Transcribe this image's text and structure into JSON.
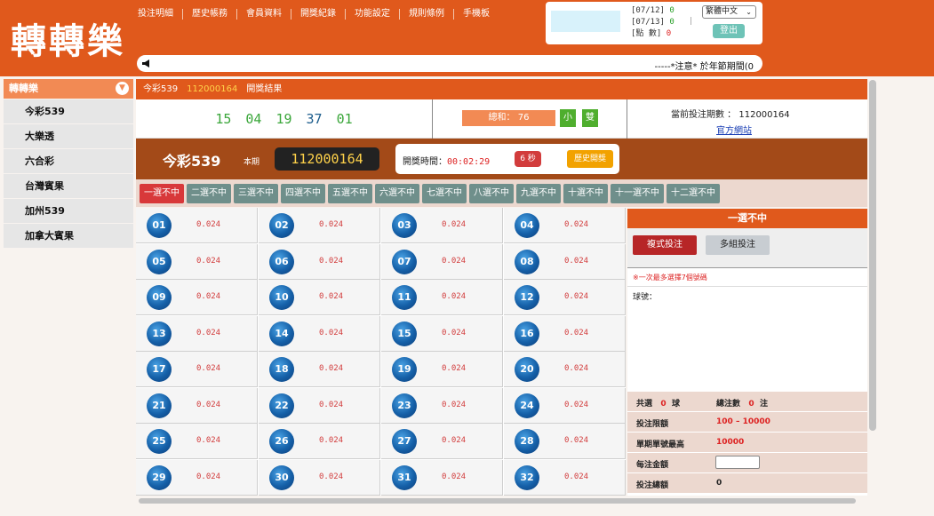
{
  "header": {
    "logo": "轉轉樂",
    "nav": [
      "投注明細",
      "歷史帳務",
      "會員資料",
      "開獎紀錄",
      "功能設定",
      "規則條例",
      "手機板"
    ],
    "stats": {
      "row1_date": "[07/12]",
      "row1_val": "0",
      "row2_date": "[07/13]",
      "row2_val": "0",
      "row3_label": "[點 數]",
      "row3_val": "0",
      "sep": "|"
    },
    "language": "繁體中文",
    "logout": "登出",
    "marquee": "-----*注意* 於年節期間(0"
  },
  "sidebar": {
    "header": "轉轉樂",
    "items": [
      "今彩539",
      "大樂透",
      "六合彩",
      "台灣賓果",
      "加州539",
      "加拿大賓果"
    ]
  },
  "lottery": {
    "title": "今彩539",
    "period": "112000164",
    "result_label": "開獎結果",
    "winning_numbers": [
      "15",
      "04",
      "19",
      "37",
      "01"
    ],
    "winning_colors": [
      "#3aa63a",
      "#3aa63a",
      "#3aa63a",
      "#1b5c8c",
      "#3aa63a"
    ],
    "sum_label": "總和： 76",
    "tags": [
      "小",
      "雙"
    ],
    "current_period_label": "當前投注期數 ： 112000164",
    "official_site": "官方網站",
    "period_label": "本期",
    "period_display": "112000164",
    "draw_time_label": "開獎時間：",
    "draw_time": "00:02:29",
    "seconds": "6 秒",
    "history": "歷史開獎"
  },
  "tabs": [
    "一選不中",
    "二選不中",
    "三選不中",
    "四選不中",
    "五選不中",
    "六選不中",
    "七選不中",
    "八選不中",
    "九選不中",
    "十選不中",
    "十一選不中",
    "十二選不中"
  ],
  "numbers": [
    {
      "n": "01",
      "odds": "0.024"
    },
    {
      "n": "02",
      "odds": "0.024"
    },
    {
      "n": "03",
      "odds": "0.024"
    },
    {
      "n": "04",
      "odds": "0.024"
    },
    {
      "n": "05",
      "odds": "0.024"
    },
    {
      "n": "06",
      "odds": "0.024"
    },
    {
      "n": "07",
      "odds": "0.024"
    },
    {
      "n": "08",
      "odds": "0.024"
    },
    {
      "n": "09",
      "odds": "0.024"
    },
    {
      "n": "10",
      "odds": "0.024"
    },
    {
      "n": "11",
      "odds": "0.024"
    },
    {
      "n": "12",
      "odds": "0.024"
    },
    {
      "n": "13",
      "odds": "0.024"
    },
    {
      "n": "14",
      "odds": "0.024"
    },
    {
      "n": "15",
      "odds": "0.024"
    },
    {
      "n": "16",
      "odds": "0.024"
    },
    {
      "n": "17",
      "odds": "0.024"
    },
    {
      "n": "18",
      "odds": "0.024"
    },
    {
      "n": "19",
      "odds": "0.024"
    },
    {
      "n": "20",
      "odds": "0.024"
    },
    {
      "n": "21",
      "odds": "0.024"
    },
    {
      "n": "22",
      "odds": "0.024"
    },
    {
      "n": "23",
      "odds": "0.024"
    },
    {
      "n": "24",
      "odds": "0.024"
    },
    {
      "n": "25",
      "odds": "0.024"
    },
    {
      "n": "26",
      "odds": "0.024"
    },
    {
      "n": "27",
      "odds": "0.024"
    },
    {
      "n": "28",
      "odds": "0.024"
    },
    {
      "n": "29",
      "odds": "0.024"
    },
    {
      "n": "30",
      "odds": "0.024"
    },
    {
      "n": "31",
      "odds": "0.024"
    },
    {
      "n": "32",
      "odds": "0.024"
    }
  ],
  "panel": {
    "title": "一選不中",
    "btn_multi": "複式投注",
    "btn_group": "多組投注",
    "hint": "※一次最多選擇7個號碼",
    "balls_label": "球號：",
    "selected_label": "共選",
    "selected_count": "0",
    "selected_unit": "球",
    "total_bets_label": "總注數",
    "total_bets": "0",
    "total_bets_unit": "注",
    "limit_label": "投注限額",
    "limit_min": "100",
    "limit_dash": "–",
    "limit_max": "10000",
    "single_max_label": "單期單號最高",
    "single_max": "10000",
    "per_bet_label": "每注金額",
    "total_amount_label": "投注總額",
    "total_amount": "0"
  }
}
